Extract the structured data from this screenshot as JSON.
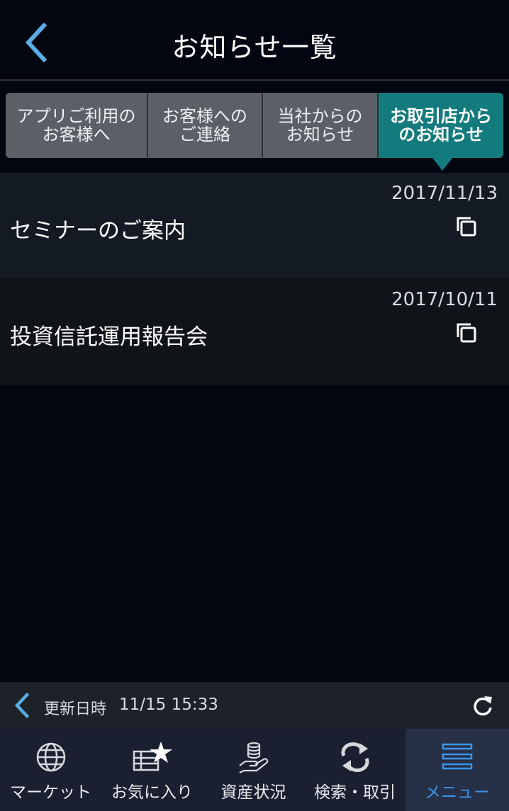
{
  "header": {
    "title": "お知らせ一覧"
  },
  "tabs": [
    {
      "label": "アプリご利用の\nお客様へ"
    },
    {
      "label": "お客様への\nご連絡"
    },
    {
      "label": "当社からの\nお知らせ"
    },
    {
      "label": "お取引店から\nのお知らせ",
      "active": true
    }
  ],
  "notices": [
    {
      "date": "2017/11/13",
      "title": "セミナーのご案内"
    },
    {
      "date": "2017/10/11",
      "title": "投資信託運用報告会"
    }
  ],
  "update_bar": {
    "label": "更新日時",
    "value": "11/15 15:33"
  },
  "bottom_nav": [
    {
      "label": "マーケット",
      "icon": "globe-icon"
    },
    {
      "label": "お気に入り",
      "icon": "favorite-star-icon"
    },
    {
      "label": "資産状況",
      "icon": "coins-hand-icon"
    },
    {
      "label": "検索・取引",
      "icon": "swap-arrows-icon"
    },
    {
      "label": "メニュー",
      "icon": "menu-icon",
      "active": true
    }
  ],
  "colors": {
    "background": "#020611",
    "tab_inactive": "#5b6066",
    "tab_active": "#137b7d",
    "accent_blue": "#3b95ea",
    "back_arrow": "#5aaee6"
  }
}
